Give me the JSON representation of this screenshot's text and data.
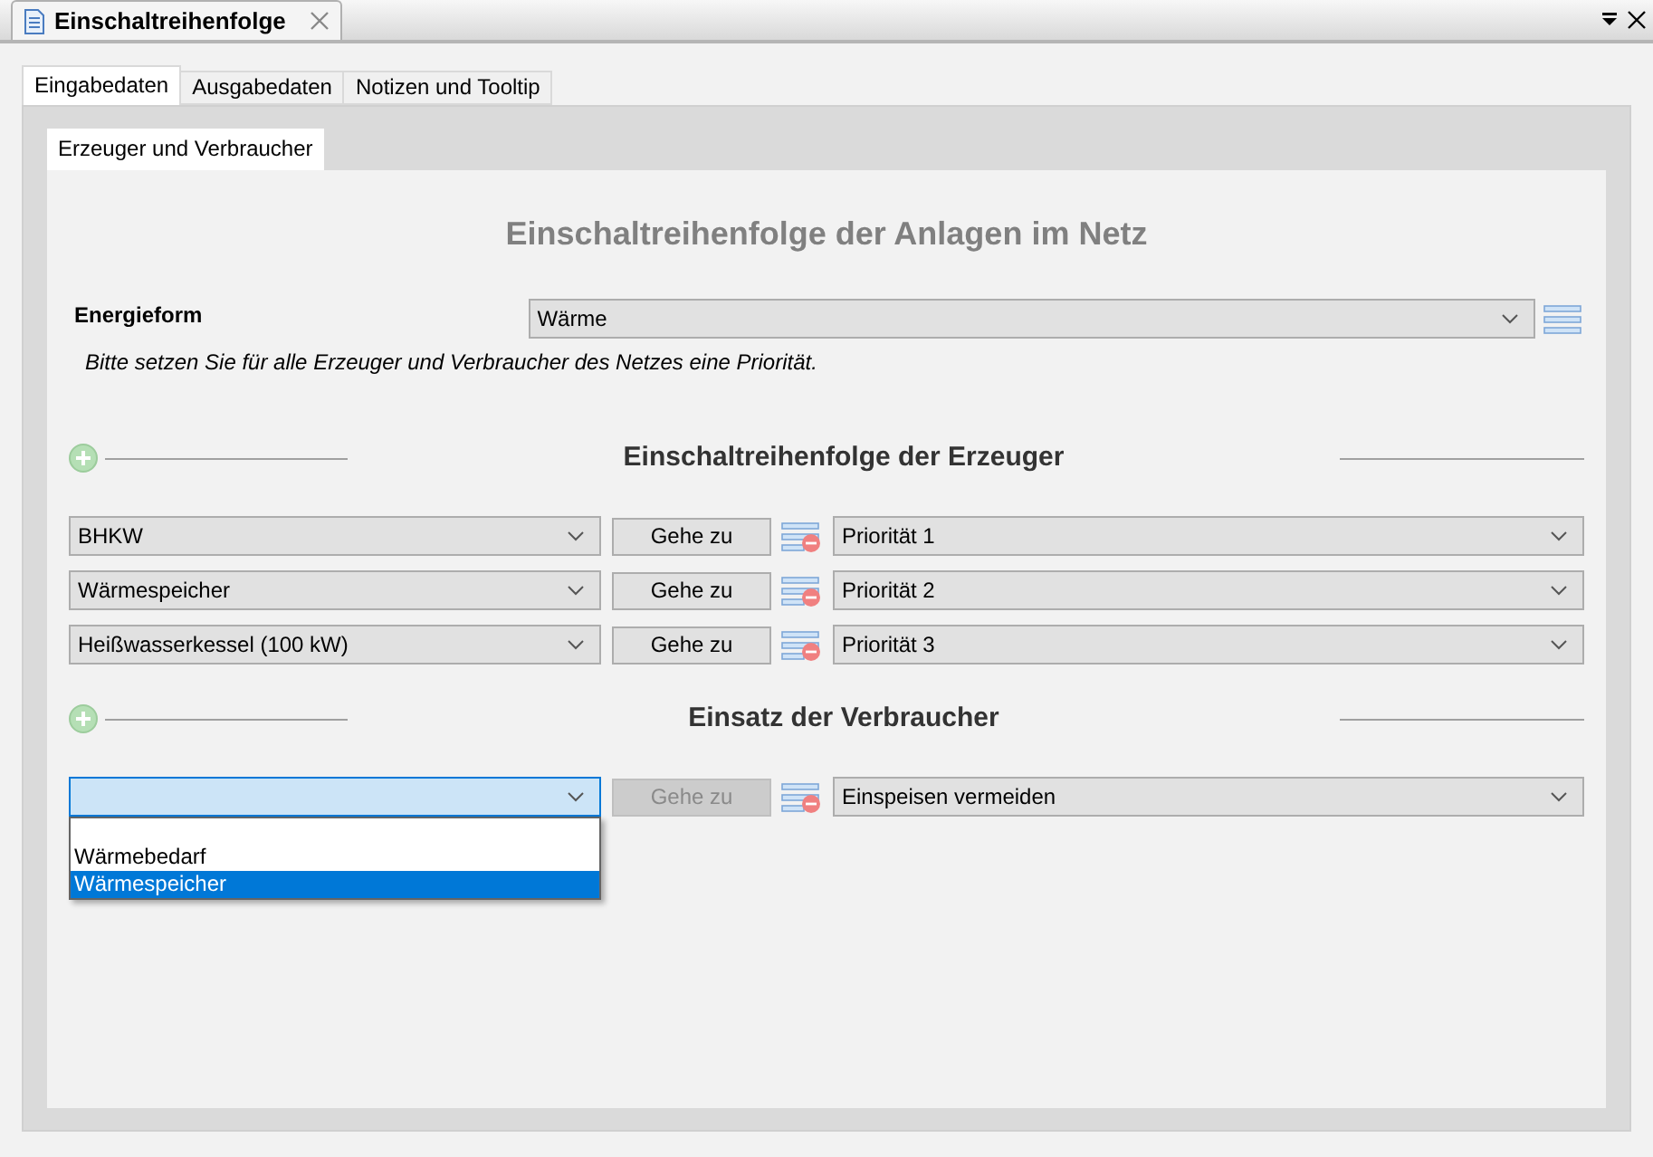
{
  "document_tab": {
    "title": "Einschaltreihenfolge"
  },
  "tabs": [
    {
      "label": "Eingabedaten",
      "selected": true
    },
    {
      "label": "Ausgabedaten",
      "selected": false
    },
    {
      "label": "Notizen und Tooltip",
      "selected": false
    }
  ],
  "subtabs": [
    {
      "label": "Erzeuger und Verbraucher",
      "selected": true
    }
  ],
  "title": "Einschaltreihenfolge der Anlagen im Netz",
  "energy_form": {
    "label": "Energieform",
    "value": "Wärme"
  },
  "hint": "Bitte setzen Sie für alle Erzeuger und Verbraucher des Netzes eine Priorität.",
  "sections": [
    {
      "heading": "Einschaltreihenfolge der Erzeuger",
      "rows": [
        {
          "value": "BHKW",
          "focused": false,
          "button": "Gehe zu",
          "button_disabled": false,
          "priority": "Priorität 1"
        },
        {
          "value": "Wärmespeicher",
          "focused": false,
          "button": "Gehe zu",
          "button_disabled": false,
          "priority": "Priorität 2"
        },
        {
          "value": "Heißwasserkessel (100 kW)",
          "focused": false,
          "button": "Gehe zu",
          "button_disabled": false,
          "priority": "Priorität 3"
        }
      ]
    },
    {
      "heading": "Einsatz der Verbraucher",
      "rows": [
        {
          "focused": true,
          "button": "Gehe zu",
          "button_disabled": true,
          "priority": "Einspeisen vermeiden",
          "open_options": [
            {
              "label": "Wärmebedarf",
              "selected": false
            },
            {
              "label": "Wärmespeicher",
              "selected": true
            }
          ]
        }
      ]
    }
  ]
}
